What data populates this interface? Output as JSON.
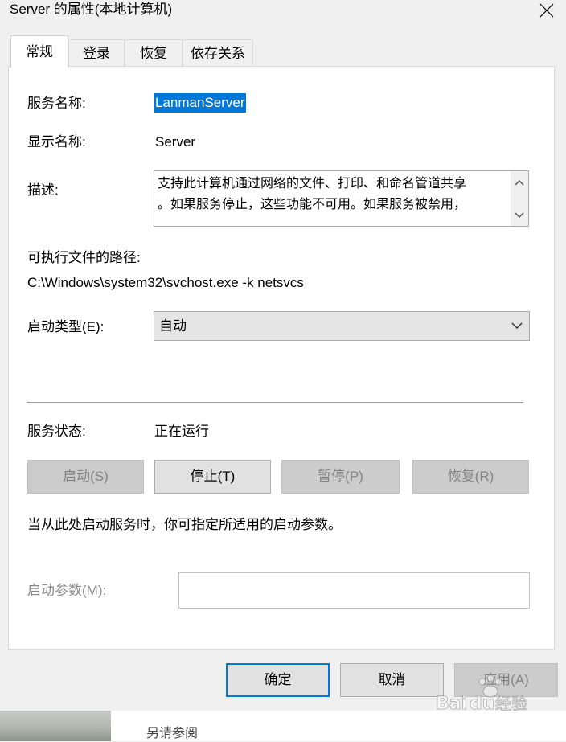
{
  "window": {
    "title": "Server 的属性(本地计算机)"
  },
  "tabs": [
    {
      "label": "常规"
    },
    {
      "label": "登录"
    },
    {
      "label": "恢复"
    },
    {
      "label": "依存关系"
    }
  ],
  "general": {
    "service_name_label": "服务名称:",
    "service_name_value": "LanmanServer",
    "display_name_label": "显示名称:",
    "display_name_value": "Server",
    "description_label": "描述:",
    "description_line1": "支持此计算机通过网络的文件、打印、和命名管道共享",
    "description_line2": "。如果服务停止，这些功能不可用。如果服务被禁用，",
    "path_label": "可执行文件的路径:",
    "path_value": "C:\\Windows\\system32\\svchost.exe -k netsvcs",
    "startup_type_label": "启动类型(E):",
    "startup_type_value": "自动",
    "status_label": "服务状态:",
    "status_value": "正在运行",
    "start_button": "启动(S)",
    "stop_button": "停止(T)",
    "pause_button": "暂停(P)",
    "resume_button": "恢复(R)",
    "hint_text": "当从此处启动服务时，你可指定所适用的启动参数。",
    "param_label": "启动参数(M):",
    "param_value": ""
  },
  "footer": {
    "ok_button": "确定",
    "cancel_button": "取消",
    "apply_button": "应用(A)"
  },
  "background": {
    "see_also_text": "另请参阅"
  },
  "watermark": {
    "text": "Baidu经验"
  },
  "colors": {
    "selection": "#0078d7",
    "default_button_border": "#0078d7"
  }
}
